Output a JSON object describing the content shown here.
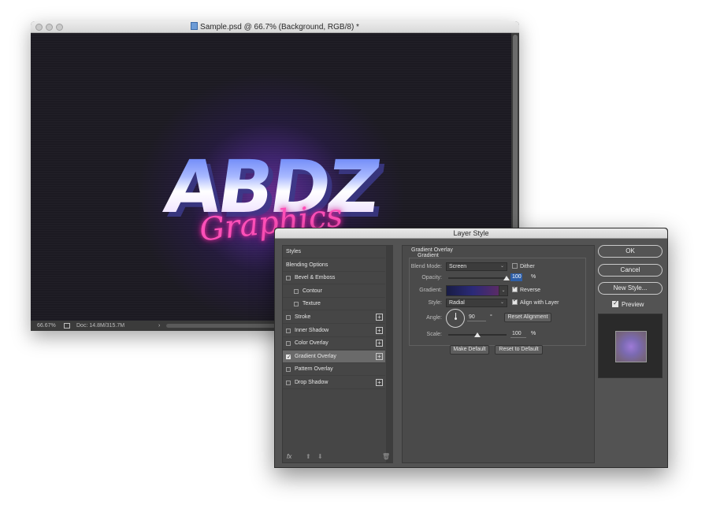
{
  "document": {
    "title": "Sample.psd @ 66.7% (Background, RGB/8) *",
    "artwork_title": "ABDZ",
    "artwork_script": "Graphics",
    "status": {
      "zoom": "66.67%",
      "doc_size": "Doc: 14.8M/315.7M",
      "arrow": "›"
    }
  },
  "dialog": {
    "title": "Layer Style",
    "styles_panel": {
      "items": [
        {
          "label": "Styles",
          "checkbox": false,
          "checked": false,
          "indent": false,
          "plus": false,
          "selected": false
        },
        {
          "label": "Blending Options",
          "checkbox": false,
          "checked": false,
          "indent": false,
          "plus": false,
          "selected": false
        },
        {
          "label": "Bevel & Emboss",
          "checkbox": true,
          "checked": false,
          "indent": false,
          "plus": false,
          "selected": false
        },
        {
          "label": "Contour",
          "checkbox": true,
          "checked": false,
          "indent": true,
          "plus": false,
          "selected": false
        },
        {
          "label": "Texture",
          "checkbox": true,
          "checked": false,
          "indent": true,
          "plus": false,
          "selected": false
        },
        {
          "label": "Stroke",
          "checkbox": true,
          "checked": false,
          "indent": false,
          "plus": true,
          "selected": false
        },
        {
          "label": "Inner Shadow",
          "checkbox": true,
          "checked": false,
          "indent": false,
          "plus": true,
          "selected": false
        },
        {
          "label": "Color Overlay",
          "checkbox": true,
          "checked": false,
          "indent": false,
          "plus": true,
          "selected": false
        },
        {
          "label": "Gradient Overlay",
          "checkbox": true,
          "checked": true,
          "indent": false,
          "plus": true,
          "selected": true
        },
        {
          "label": "Pattern Overlay",
          "checkbox": true,
          "checked": false,
          "indent": false,
          "plus": false,
          "selected": false
        },
        {
          "label": "Drop Shadow",
          "checkbox": true,
          "checked": false,
          "indent": false,
          "plus": true,
          "selected": false
        }
      ],
      "footer": {
        "fx": "fx",
        "up": "⬆",
        "down": "⬇",
        "trash": "🗑"
      }
    },
    "gradient_overlay": {
      "section_title": "Gradient Overlay",
      "subsection_title": "Gradient",
      "blend_mode_label": "Blend Mode:",
      "blend_mode_value": "Screen",
      "dither_label": "Dither",
      "dither_checked": false,
      "opacity_label": "Opacity:",
      "opacity_value": "100",
      "opacity_unit": "%",
      "opacity_level": 1.0,
      "gradient_label": "Gradient:",
      "reverse_label": "Reverse",
      "reverse_checked": true,
      "style_label": "Style:",
      "style_value": "Radial",
      "align_label": "Align with Layer",
      "align_checked": true,
      "angle_label": "Angle:",
      "angle_value": "90",
      "angle_unit": "°",
      "reset_alignment_label": "Reset Alignment",
      "scale_label": "Scale:",
      "scale_value": "100",
      "scale_unit": "%",
      "scale_level": 0.5,
      "make_default_label": "Make Default",
      "reset_default_label": "Reset to Default"
    },
    "buttons": {
      "ok": "OK",
      "cancel": "Cancel",
      "new_style": "New Style..."
    },
    "preview": {
      "label": "Preview",
      "checked": true
    }
  }
}
